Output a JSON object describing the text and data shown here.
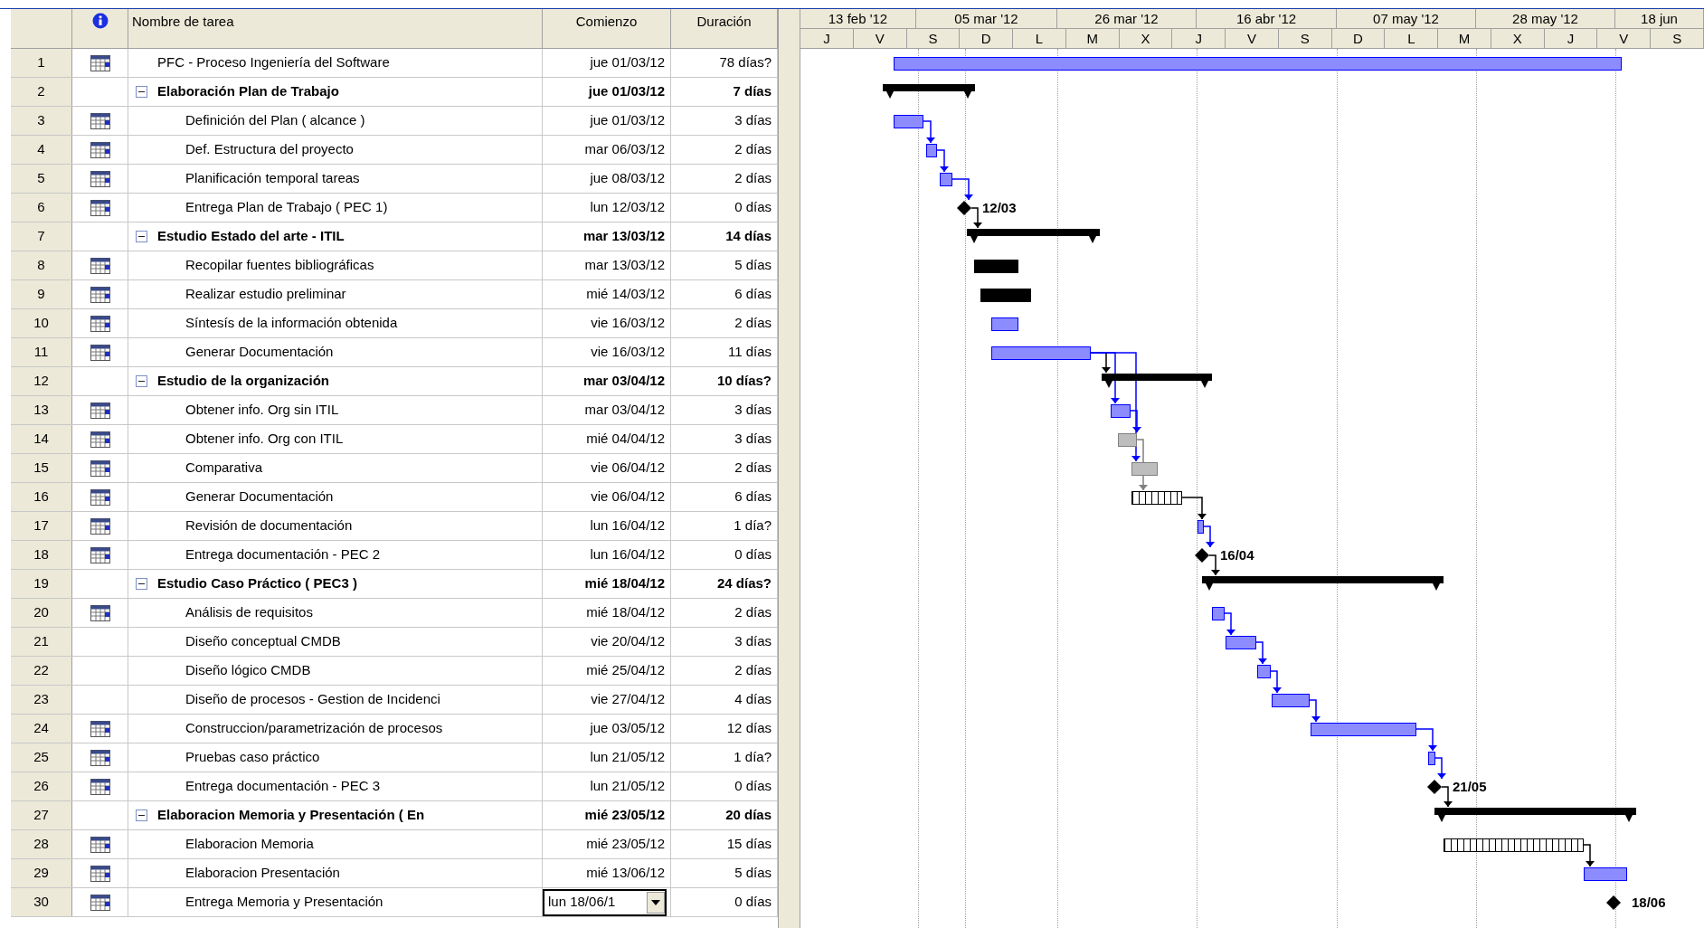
{
  "table": {
    "columns": [
      "Nombre de tarea",
      "Comienzo",
      "Duración"
    ]
  },
  "timescale": {
    "major": [
      "13 feb '12",
      "05 mar '12",
      "26 mar '12",
      "16 abr '12",
      "07 may '12",
      "28 may '12",
      "18 jun"
    ],
    "minor": [
      "J",
      "V",
      "S",
      "D",
      "L",
      "M",
      "X",
      "J",
      "V",
      "S",
      "D",
      "L",
      "M",
      "X",
      "J",
      "V",
      "S"
    ]
  },
  "tasks": [
    {
      "id": "1",
      "indicator": true,
      "name": "PFC - Proceso Ingeniería del Software",
      "start": "jue 01/03/12",
      "duration": "78 días?",
      "editing": false
    },
    {
      "id": "2",
      "indicator": false,
      "name": "Elaboración Plan de Trabajo",
      "start": "jue 01/03/12",
      "duration": "7 días",
      "editing": false,
      "expanded": true,
      "children": [
        {
          "id": "3",
          "indicator": true,
          "name": "Definición del Plan ( alcance )",
          "start": "jue 01/03/12",
          "duration": "3 días",
          "editing": false
        },
        {
          "id": "4",
          "indicator": true,
          "name": "Def. Estructura del proyecto",
          "start": "mar 06/03/12",
          "duration": "2 días",
          "editing": false
        },
        {
          "id": "5",
          "indicator": true,
          "name": "Planificación temporal tareas",
          "start": "jue 08/03/12",
          "duration": "2 días",
          "editing": false
        },
        {
          "id": "6",
          "indicator": true,
          "name": "Entrega Plan de Trabajo ( PEC 1)",
          "start": "lun 12/03/12",
          "duration": "0 días",
          "editing": false,
          "milestone_label": "12/03"
        }
      ]
    },
    {
      "id": "7",
      "indicator": false,
      "name": "Estudio Estado del arte - ITIL",
      "start": "mar 13/03/12",
      "duration": "14 días",
      "editing": false,
      "expanded": true,
      "children": [
        {
          "id": "8",
          "indicator": true,
          "name": "Recopilar fuentes bibliográficas",
          "start": "mar 13/03/12",
          "duration": "5 días",
          "editing": false
        },
        {
          "id": "9",
          "indicator": true,
          "name": "Realizar estudio preliminar",
          "start": "mié 14/03/12",
          "duration": "6 días",
          "editing": false
        },
        {
          "id": "10",
          "indicator": true,
          "name": "Síntesís de la información obtenida",
          "start": "vie 16/03/12",
          "duration": "2 días",
          "editing": false
        },
        {
          "id": "11",
          "indicator": true,
          "name": "Generar Documentación",
          "start": "vie 16/03/12",
          "duration": "11 días",
          "editing": false
        }
      ]
    },
    {
      "id": "12",
      "indicator": false,
      "name": "Estudio de la organización",
      "start": "mar 03/04/12",
      "duration": "10 días?",
      "editing": false,
      "expanded": true,
      "children": [
        {
          "id": "13",
          "indicator": true,
          "name": "Obtener info. Org sin ITIL",
          "start": "mar 03/04/12",
          "duration": "3 días",
          "editing": false
        },
        {
          "id": "14",
          "indicator": true,
          "name": "Obtener info. Org con ITIL",
          "start": "mié 04/04/12",
          "duration": "3 días",
          "editing": false
        },
        {
          "id": "15",
          "indicator": true,
          "name": "Comparativa",
          "start": "vie 06/04/12",
          "duration": "2 días",
          "editing": false
        },
        {
          "id": "16",
          "indicator": true,
          "name": "Generar Documentación",
          "start": "vie 06/04/12",
          "duration": "6 días",
          "editing": false
        },
        {
          "id": "17",
          "indicator": true,
          "name": "Revisión de documentación",
          "start": "lun 16/04/12",
          "duration": "1 día?",
          "editing": false
        },
        {
          "id": "18",
          "indicator": true,
          "name": "Entrega documentación - PEC 2",
          "start": "lun 16/04/12",
          "duration": "0 días",
          "editing": false,
          "milestone_label": "16/04"
        }
      ]
    },
    {
      "id": "19",
      "indicator": false,
      "name": "Estudio Caso Práctico ( PEC3 )",
      "start": "mié 18/04/12",
      "duration": "24 días?",
      "editing": false,
      "expanded": true,
      "children": [
        {
          "id": "20",
          "indicator": true,
          "name": "Análisis de requisitos",
          "start": "mié 18/04/12",
          "duration": "2 días",
          "editing": false
        },
        {
          "id": "21",
          "indicator": false,
          "name": "Diseño conceptual CMDB",
          "start": "vie 20/04/12",
          "duration": "3 días",
          "editing": false
        },
        {
          "id": "22",
          "indicator": false,
          "name": "Diseño lógico CMDB",
          "start": "mié 25/04/12",
          "duration": "2 días",
          "editing": false
        },
        {
          "id": "23",
          "indicator": false,
          "name": "Diseño de procesos - Gestion de Incidenci",
          "start": "vie 27/04/12",
          "duration": "4 días",
          "editing": false
        },
        {
          "id": "24",
          "indicator": true,
          "name": "Construccion/parametrización de procesos",
          "start": "jue 03/05/12",
          "duration": "12 días",
          "editing": false
        },
        {
          "id": "25",
          "indicator": true,
          "name": "Pruebas caso práctico",
          "start": "lun 21/05/12",
          "duration": "1 día?",
          "editing": false
        },
        {
          "id": "26",
          "indicator": true,
          "name": "Entrega documentación - PEC 3",
          "start": "lun 21/05/12",
          "duration": "0 días",
          "editing": false,
          "milestone_label": "21/05"
        }
      ]
    },
    {
      "id": "27",
      "indicator": false,
      "name": "Elaboracion Memoria y Presentación ( En",
      "start": "mié 23/05/12",
      "duration": "20 días",
      "editing": false,
      "expanded": true,
      "children": [
        {
          "id": "28",
          "indicator": true,
          "name": "Elaboracion Memoria",
          "start": "mié 23/05/12",
          "duration": "15 días",
          "editing": false
        },
        {
          "id": "29",
          "indicator": true,
          "name": "Elaboracion Presentación",
          "start": "mié 13/06/12",
          "duration": "5 días",
          "editing": false
        },
        {
          "id": "30",
          "indicator": true,
          "name": "Entrega Memoria y Presentación",
          "start": "lun 18/06/1",
          "duration": "0 días",
          "editing": true,
          "milestone_label": "18/06"
        }
      ]
    }
  ]
}
